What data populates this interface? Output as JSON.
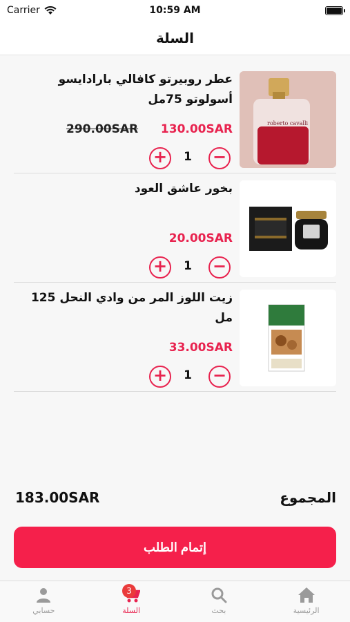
{
  "status_bar": {
    "carrier": "Carrier",
    "time": "10:59 AM"
  },
  "header": {
    "title": "السلة"
  },
  "cart": {
    "items": [
      {
        "name": "عطر روبيرتو كافالي بارادايسو أسولوتو 75مل",
        "price": "130.00SAR",
        "old_price": "290.00SAR",
        "quantity": "1",
        "image": "perfume-bottle-image"
      },
      {
        "name": "بخور عاشق العود",
        "price": "20.00SAR",
        "quantity": "1",
        "image": "incense-box-image"
      },
      {
        "name": "زيت اللوز المر من وادي النحل 125 مل",
        "price": "33.00SAR",
        "quantity": "1",
        "image": "almond-oil-box-image"
      }
    ]
  },
  "summary": {
    "total_label": "المجموع",
    "total_value": "183.00SAR"
  },
  "checkout": {
    "label": "إتمام الطلب"
  },
  "tab_bar": {
    "tabs": [
      {
        "label": "حسابي",
        "icon": "person-icon"
      },
      {
        "label": "السلة",
        "icon": "cart-icon",
        "badge": "3",
        "active": true
      },
      {
        "label": "بحث",
        "icon": "search-icon"
      },
      {
        "label": "الرئيسية",
        "icon": "home-icon"
      }
    ]
  },
  "colors": {
    "accent": "#e8234f",
    "button": "#f5204b",
    "tab_inactive": "#9a9a9a"
  }
}
